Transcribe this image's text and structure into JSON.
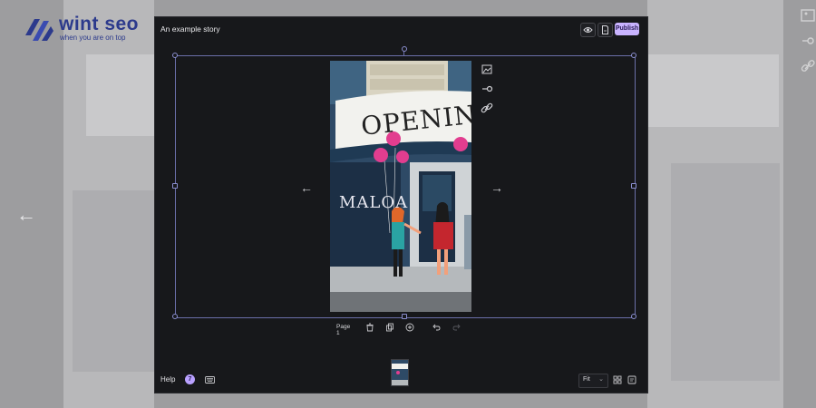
{
  "brand": {
    "name": "wint seo",
    "tagline": "when you are on top",
    "color": "#2c3a8c"
  },
  "editor": {
    "story_title": "An example story",
    "toolbar": {
      "preview_icon": "eye-icon",
      "save_icon": "document-icon",
      "publish_label": "Publish"
    },
    "accent": "#c9b3ff",
    "page": {
      "sign_text": "OPENING",
      "shop_text": "MALOA"
    },
    "page_bar": {
      "label": "Page 1"
    },
    "footer": {
      "help_label": "Help",
      "help_count": "7",
      "zoom_value": "Fit"
    }
  }
}
